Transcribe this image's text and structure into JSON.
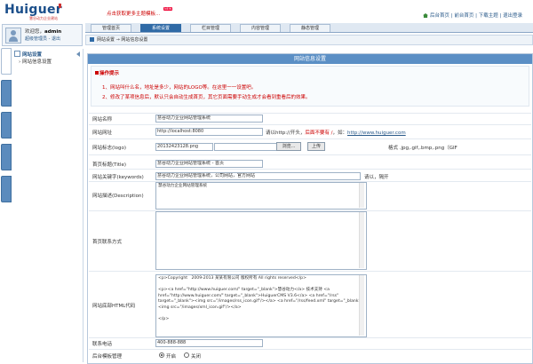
{
  "brand": {
    "logo": "Huiguer",
    "slogan": "慧谷动力企业建站"
  },
  "promo": {
    "text": "点击获取更多主题模板...",
    "badge": "NEW"
  },
  "top_links": {
    "home": "后台首页",
    "site_home": "前台首页",
    "download": "下载主题",
    "logout": "退出登录"
  },
  "user": {
    "welcome": "欢迎您，",
    "name": "admin",
    "links": "超级管理员 - 退出"
  },
  "tabs": [
    "管理首页",
    "系统设置",
    "栏目管理",
    "内容管理",
    "静态管理"
  ],
  "active_tab": 1,
  "sidenav": {
    "title": "网站设置",
    "items": [
      "网站信息设置"
    ]
  },
  "breadcrumb": "网站设置 → 网站信息设置",
  "panel": {
    "title": "网站信息设置",
    "tips_title": "操作提示",
    "tips": [
      "1、网站叫什么名，地址是多少，网站的LOGO等。在这里一一设置吧。",
      "2、修改了某项信息后，默认只会自动生成首页，其它页面需要手动生成才会看到重看后的效果。"
    ]
  },
  "form": {
    "name_label": "网站名称",
    "name_value": "慧谷动力企业网站管理系统",
    "url_label": "网站网址",
    "url_value": "http://localhost:8080",
    "url_hint_pre": "请以http://开头，",
    "url_hint_red": "后面不要有 /",
    "url_hint_mid": "，如：",
    "url_hint_link": "http://www.huiguer.com",
    "logo_label": "网站标志(logo)",
    "logo_value": "20132423128.png",
    "browse_label": "浏览...",
    "upload_label": "上传",
    "logo_hint": "格式 .jpg,.gif,.bmp,.png（GIF",
    "title_label": "首页标题(Title)",
    "title_value": "慧谷动力企业网站管理系统 - 首页",
    "keywords_label": "网站关键字(keywords)",
    "keywords_value": "慧谷动力企业网站管理系统，公司网站，官方网站",
    "keywords_hint": "请以，隔开",
    "desc_label": "网站描述(Description)",
    "desc_value": "慧谷动力企业网站管理系统",
    "contact_label": "首页联系方式",
    "contact_value": "",
    "footer_label": "网站底部HTML代码",
    "footer_value": "<p>Copyright   2009-2013 某某有限公司 版权所有 All rights reserved</p>\n\n<p><a href=\"http://www.huiguer.com/\" target=\"_blank\">慧谷动力</a> 技术支持 <a href=\"http://www.huiguer.com/\" target=\"_blank\">HuiguerCMS V3.6</a> <a href=\"/rss\" target=\"_blank\"><img src=\"/images/rss_icon.gif\"/></a> <a href=\"/rss/feed.xml\" target=\"_blank\"><img src=\"/images/xml_icon.gif\"/></a>\n\n</p>",
    "phone_label": "联系电话",
    "phone_value": "400-888-888",
    "template_label": "后台模板管理",
    "radio_on": "开启",
    "radio_off": "关闭"
  }
}
